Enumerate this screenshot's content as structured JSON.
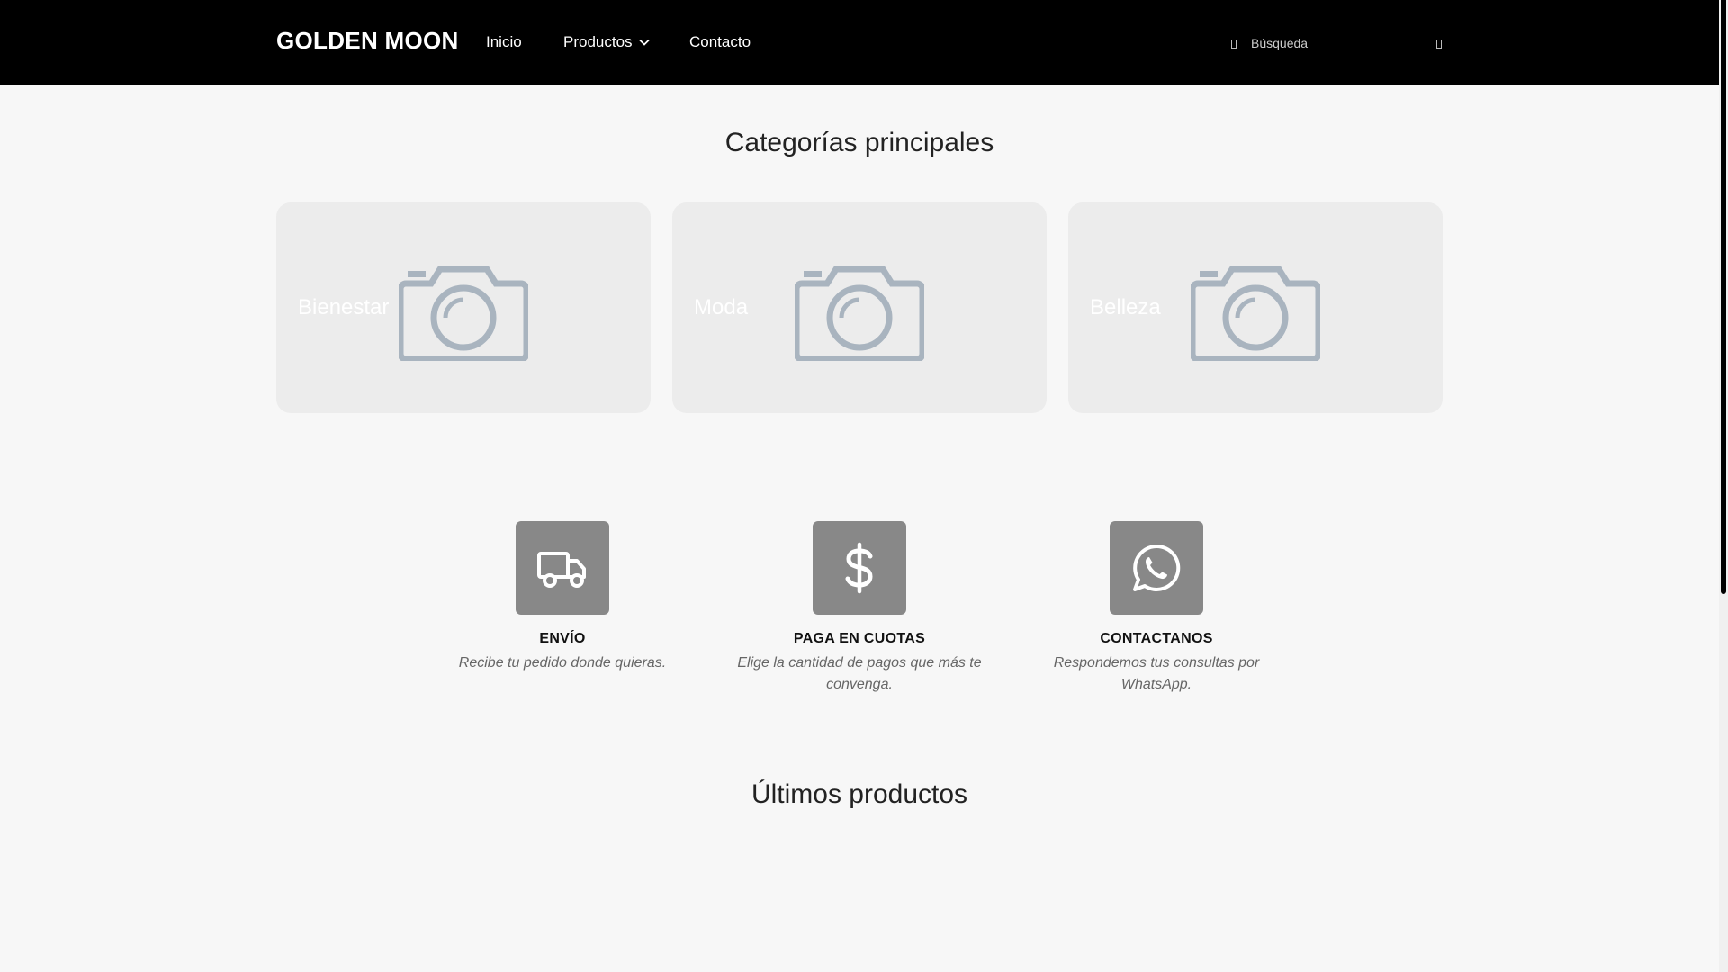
{
  "header": {
    "brand": "GOLDEN MOON",
    "nav": {
      "inicio": "Inicio",
      "productos": "Productos",
      "contacto": "Contacto"
    },
    "search": {
      "placeholder": "Búsqueda"
    }
  },
  "categories": {
    "title": "Categorías principales",
    "items": [
      {
        "label": "Bienestar"
      },
      {
        "label": "Moda"
      },
      {
        "label": "Belleza"
      }
    ]
  },
  "features": [
    {
      "icon": "truck-icon",
      "title": "ENVÍO",
      "description": "Recibe tu pedido donde quieras."
    },
    {
      "icon": "dollar-icon",
      "title": "PAGA EN CUOTAS",
      "description": "Elige la cantidad de pagos que más te convenga."
    },
    {
      "icon": "whatsapp-icon",
      "title": "CONTACTANOS",
      "description": "Respondemos tus consultas por WhatsApp."
    }
  ],
  "latest": {
    "title": "Últimos productos"
  },
  "colors": {
    "header_bg": "#000000",
    "page_bg": "#f7f7f7",
    "card_bg": "#ececec",
    "icon_box": "#888888",
    "camera_icon": "#a9b4bf"
  }
}
